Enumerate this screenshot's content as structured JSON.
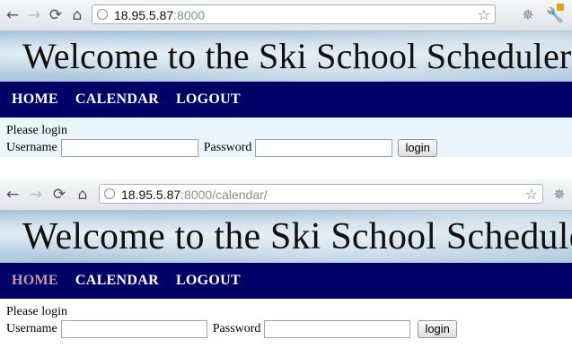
{
  "shot1": {
    "browser": {
      "host": "18.95.5.87",
      "path": ":8000"
    },
    "site": {
      "title": "Welcome to the Ski School Scheduler",
      "menu": [
        "HOME",
        "CALENDAR",
        "LOGOUT"
      ]
    },
    "login": {
      "prompt": "Please login",
      "username_label": "Username",
      "username_value": "",
      "password_label": "Password",
      "password_value": "",
      "button": "login"
    }
  },
  "shot2": {
    "browser": {
      "host": "18.95.5.87",
      "path": ":8000/calendar/"
    },
    "site": {
      "title": "Welcome to the Ski School Scheduler",
      "menu": [
        "HOME",
        "CALENDAR",
        "LOGOUT"
      ],
      "visited_color": "#c59aa9"
    },
    "login": {
      "prompt": "Please login",
      "username_label": "Username",
      "username_value": "",
      "password_label": "Password",
      "password_value": "",
      "button": "login"
    }
  },
  "colors": {
    "nav_bg": "#000066",
    "content_bg": "#eaf6fb"
  },
  "icons": [
    "back-arrow-icon",
    "forward-arrow-icon",
    "reload-icon",
    "home-icon",
    "globe-icon",
    "star-icon",
    "extension-icon",
    "wrench-icon"
  ]
}
